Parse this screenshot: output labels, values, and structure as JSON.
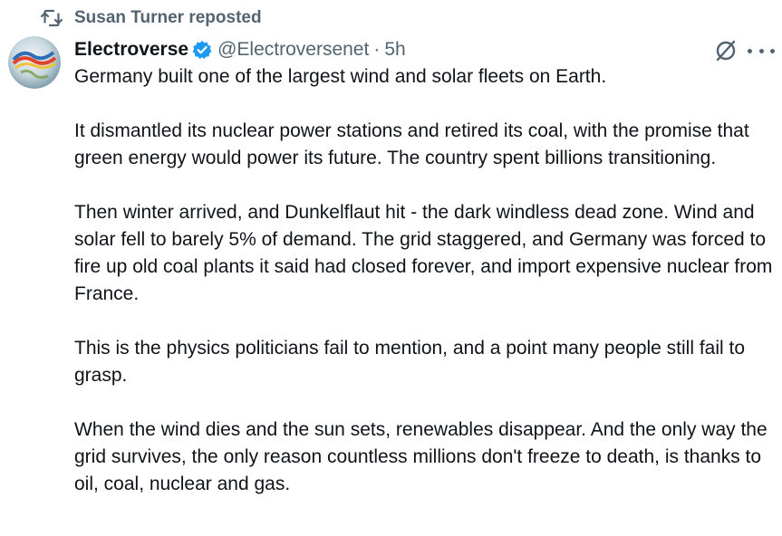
{
  "repost": {
    "label": "Susan Turner reposted",
    "icon": "repost-icon"
  },
  "author": {
    "display_name": "Electroverse",
    "handle": "@Electroversenet",
    "separator": "·",
    "time": "5h",
    "verified": true,
    "verified_color": "#1d9bf0"
  },
  "tweet": {
    "paragraphs": [
      "Germany built one of the largest wind and solar fleets on Earth.",
      "It dismantled its nuclear power stations and retired its coal, with the promise that green energy would power its future. The country spent billions transitioning.",
      "Then winter arrived, and Dunkelflaut hit - the dark windless dead zone. Wind and solar fell to barely 5% of demand. The grid staggered, and Germany was forced to fire up old coal plants it said had closed forever, and import expensive nuclear from France.",
      "This is the physics politicians fail to mention, and a point many people still fail to grasp.",
      "When the wind dies and the sun sets, renewables disappear. And the only way the grid survives, the only reason countless millions don't freeze to death, is thanks to oil, coal, nuclear and gas."
    ]
  },
  "icons": {
    "grok": "grok-icon",
    "more": "more-icon",
    "avatar": "avatar"
  },
  "colors": {
    "text": "#0f1419",
    "secondary": "#536471",
    "background": "#ffffff"
  }
}
